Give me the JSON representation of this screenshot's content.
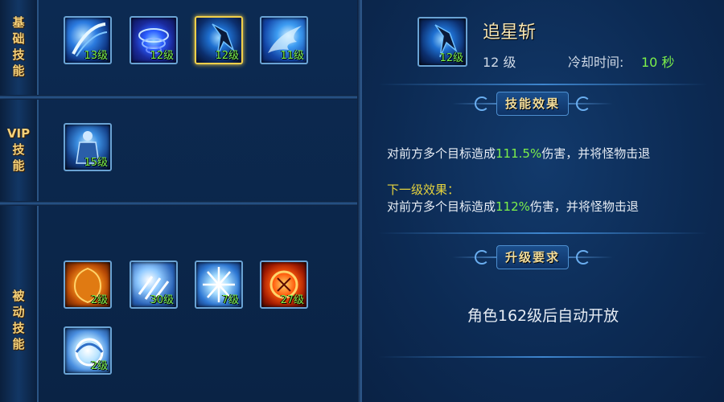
{
  "sections": {
    "basic": {
      "label": [
        "基",
        "础",
        "技",
        "能"
      ]
    },
    "vip": {
      "label": [
        "VIP",
        "技",
        "能"
      ]
    },
    "passive": {
      "label": [
        "被",
        "动",
        "技",
        "能"
      ]
    }
  },
  "basic_skills": [
    {
      "icon": "blue-slash-icon",
      "level": "13级"
    },
    {
      "icon": "blue-vortex-icon",
      "level": "12级"
    },
    {
      "icon": "star-chaser-slash-icon",
      "level": "12级"
    },
    {
      "icon": "ice-wing-icon",
      "level": "11级"
    }
  ],
  "vip_skills": [
    {
      "icon": "armored-warrior-icon",
      "level": "15级"
    }
  ],
  "passive_skills": [
    {
      "icon": "fire-shield-icon",
      "level": "2级"
    },
    {
      "icon": "ice-claw-icon",
      "level": "30级"
    },
    {
      "icon": "frost-burst-icon",
      "level": "7级"
    },
    {
      "icon": "flame-orb-icon",
      "level": "27级"
    },
    {
      "icon": "frost-orb-icon",
      "level": "2级"
    }
  ],
  "detail": {
    "name": "追星斩",
    "icon_level": "12级",
    "level": "12 级",
    "cooldown_label": "冷却时间:",
    "cooldown_value": "10 秒",
    "effect_title": "技能效果",
    "effect": {
      "pre": "对前方多个目标造成",
      "value": "111.5%",
      "post": "伤害，并将怪物击退"
    },
    "next_label": "下一级效果：",
    "next_effect": {
      "pre": "对前方多个目标造成",
      "value": "112%",
      "post": "伤害，并将怪物击退"
    },
    "require_title": "升级要求",
    "require_text": "角色162级后自动开放"
  },
  "colors": {
    "level_green": "#7cf04a",
    "label_gold": "#f3d07a",
    "next_yellow": "#e7d43d",
    "selected_border": "#f2d04a"
  }
}
